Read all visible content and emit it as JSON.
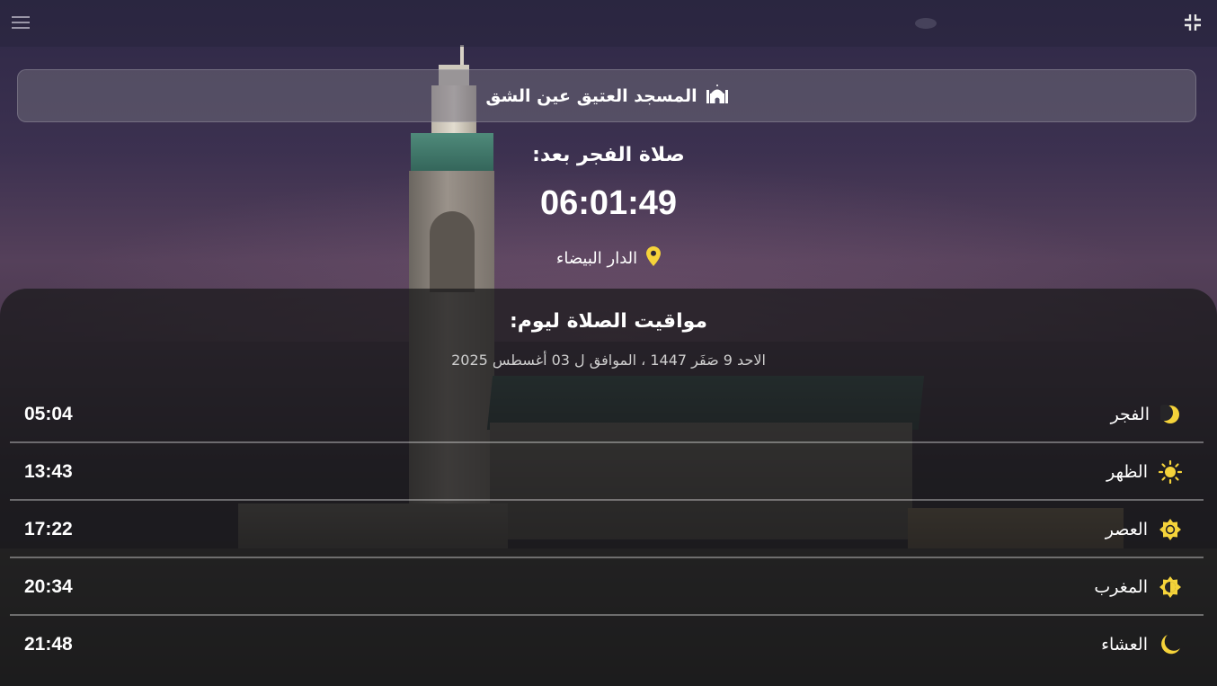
{
  "header": {
    "menu_icon": "hamburger-menu-icon",
    "shrink_icon": "exit-fullscreen-icon"
  },
  "mosque": {
    "name": "المسجد العتيق عين الشق",
    "icon": "mosque-icon"
  },
  "countdown": {
    "label": "صلاة الفجر بعد:",
    "time": "06:01:49"
  },
  "location": {
    "city": "الدار البيضاء",
    "icon": "location-pin-icon"
  },
  "schedule": {
    "title": "مواقيت الصلاة ليوم:",
    "date": "الاحد 9 صَفَر 1447 ، الموافق ل 03 أغسطس 2025",
    "prayers": [
      {
        "name": "الفجر",
        "time": "05:04",
        "icon": "crescent-moon-icon"
      },
      {
        "name": "الظهر",
        "time": "13:43",
        "icon": "sun-icon"
      },
      {
        "name": "العصر",
        "time": "17:22",
        "icon": "sun-badge-icon"
      },
      {
        "name": "المغرب",
        "time": "20:34",
        "icon": "half-sun-icon"
      },
      {
        "name": "العشاء",
        "time": "21:48",
        "icon": "night-moon-icon"
      }
    ]
  },
  "colors": {
    "accent_yellow": "#f5d33a",
    "panel_bg": "#19191b",
    "text": "#ffffff",
    "subtext": "#cfcfcf"
  }
}
